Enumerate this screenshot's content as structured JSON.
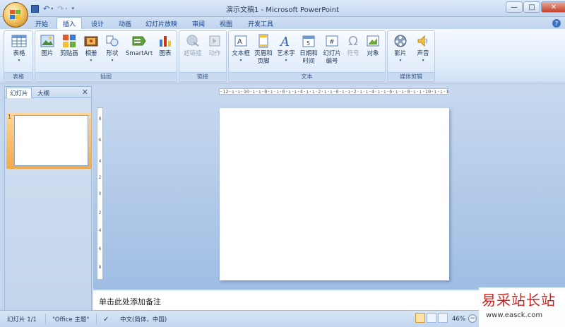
{
  "window": {
    "title": "演示文稿1 - Microsoft PowerPoint"
  },
  "tabs": [
    {
      "label": "开始"
    },
    {
      "label": "插入"
    },
    {
      "label": "设计"
    },
    {
      "label": "动画"
    },
    {
      "label": "幻灯片放映"
    },
    {
      "label": "审阅"
    },
    {
      "label": "视图"
    },
    {
      "label": "开发工具"
    }
  ],
  "active_tab": "插入",
  "ribbon": {
    "groups": {
      "table": "表格",
      "illustrations": "插图",
      "links": "链接",
      "text": "文本",
      "media": "媒体剪辑"
    },
    "buttons": {
      "table": "表格",
      "picture": "图片",
      "clipart": "剪贴画",
      "album": "相册",
      "shapes": "形状",
      "smartart": "SmartArt",
      "chart": "图表",
      "hyperlink": "超链接",
      "action": "动作",
      "textbox": "文本框",
      "header_l1": "页眉和",
      "header_l2": "页脚",
      "wordart": "艺术字",
      "datetime_l1": "日期和",
      "datetime_l2": "时间",
      "slidenum_l1": "幻灯片",
      "slidenum_l2": "编号",
      "symbol": "符号",
      "object": "对象",
      "movie": "影片",
      "sound": "声音"
    }
  },
  "panel": {
    "tab_slides": "幻灯片",
    "tab_outline": "大纲",
    "slide_number": "1"
  },
  "ruler": {
    "horizontal": "·12·ı·ı·10·ı·ı·8·ı·ı·6·ı·ı·4·ı·ı·2·ı·ı·0·ı·ı·2·ı·ı·4·ı·ı·6·ı·ı·8·ı·ı·10·ı·ı·12·"
  },
  "notes": {
    "placeholder": "单击此处添加备注"
  },
  "status": {
    "slide": "幻灯片 1/1",
    "theme": "\"Office 主题\"",
    "language": "中文(简体，中国)",
    "zoom": "46%"
  },
  "watermark": {
    "main": "易采站长站",
    "sub": "www.easck.com"
  }
}
